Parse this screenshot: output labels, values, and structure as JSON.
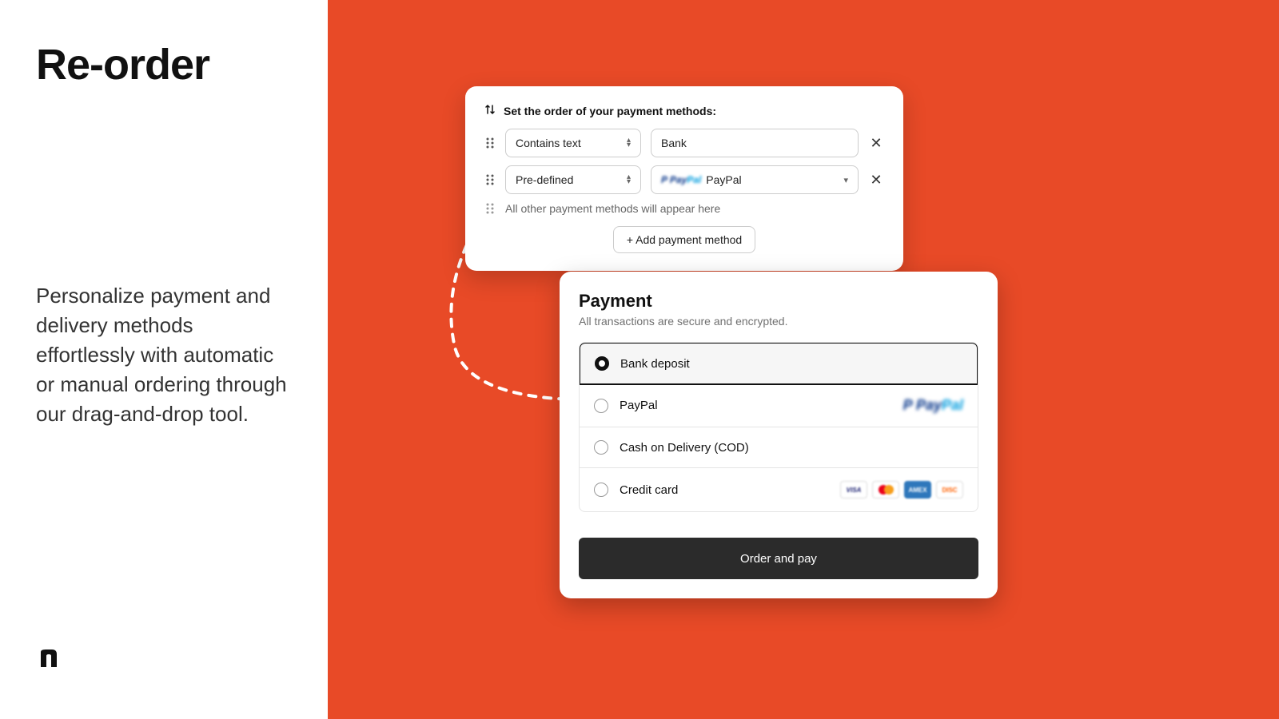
{
  "left": {
    "heading": "Re-order",
    "description": "Personalize payment and delivery methods effortlessly with automatic or manual ordering through our drag-and-drop tool."
  },
  "config": {
    "title": "Set the order of your payment methods:",
    "rows": [
      {
        "condition": "Contains text",
        "value": "Bank",
        "value_type": "text"
      },
      {
        "condition": "Pre-defined",
        "value": "PayPal",
        "value_type": "select"
      }
    ],
    "rest_label": "All other payment methods will appear here",
    "add_label": "+ Add payment method"
  },
  "checkout": {
    "title": "Payment",
    "subtitle": "All transactions are secure and encrypted.",
    "options": [
      {
        "label": "Bank deposit",
        "selected": true,
        "logos": []
      },
      {
        "label": "PayPal",
        "selected": false,
        "logos": [
          "paypal"
        ]
      },
      {
        "label": "Cash on Delivery (COD)",
        "selected": false,
        "logos": []
      },
      {
        "label": "Credit card",
        "selected": false,
        "logos": [
          "visa",
          "mastercard",
          "amex",
          "discover"
        ]
      }
    ],
    "cta": "Order and pay"
  }
}
